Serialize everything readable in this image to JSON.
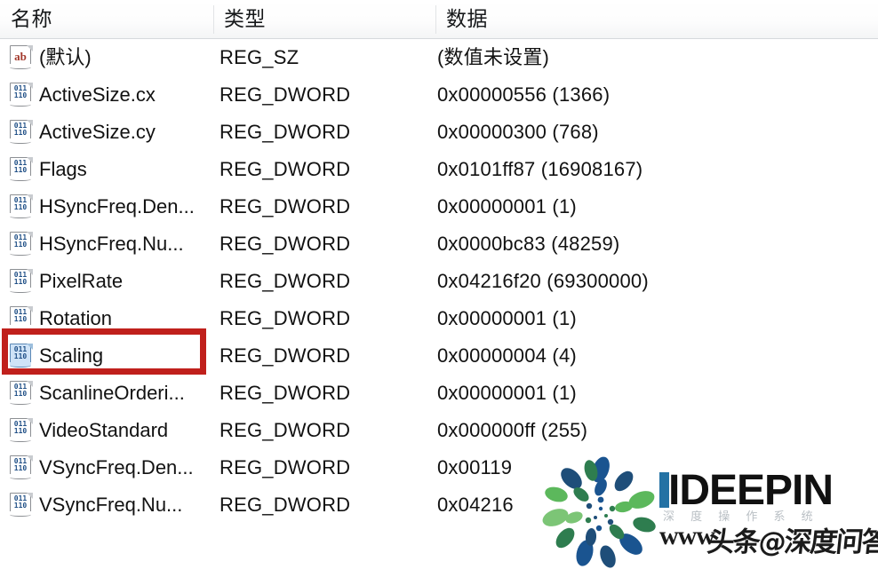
{
  "window": {
    "app": "registry-editor-value-list"
  },
  "columns": {
    "name": "名称",
    "type": "类型",
    "data": "数据"
  },
  "rows": [
    {
      "icon": "string-value-icon",
      "name": "(默认)",
      "type": "REG_SZ",
      "data": "(数值未设置)",
      "selected": false
    },
    {
      "icon": "dword-value-icon",
      "name": "ActiveSize.cx",
      "type": "REG_DWORD",
      "data": "0x00000556 (1366)",
      "selected": false
    },
    {
      "icon": "dword-value-icon",
      "name": "ActiveSize.cy",
      "type": "REG_DWORD",
      "data": "0x00000300 (768)",
      "selected": false
    },
    {
      "icon": "dword-value-icon",
      "name": "Flags",
      "type": "REG_DWORD",
      "data": "0x0101ff87 (16908167)",
      "selected": false
    },
    {
      "icon": "dword-value-icon",
      "name": "HSyncFreq.Den...",
      "type": "REG_DWORD",
      "data": "0x00000001 (1)",
      "selected": false
    },
    {
      "icon": "dword-value-icon",
      "name": "HSyncFreq.Nu...",
      "type": "REG_DWORD",
      "data": "0x0000bc83 (48259)",
      "selected": false
    },
    {
      "icon": "dword-value-icon",
      "name": "PixelRate",
      "type": "REG_DWORD",
      "data": "0x04216f20 (69300000)",
      "selected": false
    },
    {
      "icon": "dword-value-icon",
      "name": "Rotation",
      "type": "REG_DWORD",
      "data": "0x00000001 (1)",
      "selected": false
    },
    {
      "icon": "dword-value-icon",
      "name": "Scaling",
      "type": "REG_DWORD",
      "data": "0x00000004 (4)",
      "selected": true
    },
    {
      "icon": "dword-value-icon",
      "name": "ScanlineOrderi...",
      "type": "REG_DWORD",
      "data": "0x00000001 (1)",
      "selected": false
    },
    {
      "icon": "dword-value-icon",
      "name": "VideoStandard",
      "type": "REG_DWORD",
      "data": "0x000000ff (255)",
      "selected": false
    },
    {
      "icon": "dword-value-icon",
      "name": "VSyncFreq.Den...",
      "type": "REG_DWORD",
      "data": "0x00119",
      "selected": false
    },
    {
      "icon": "dword-value-icon",
      "name": "VSyncFreq.Nu...",
      "type": "REG_DWORD",
      "data": "0x04216",
      "selected": false
    }
  ],
  "annotation": {
    "shape": "rectangle",
    "target": "Scaling",
    "color": "#c0201c"
  },
  "watermark": {
    "brand": "IDEEPIN",
    "subtitle": "深 度 操 作 系 统",
    "url": "www",
    "cn_text": "头条@深度问答",
    "logo_colors": [
      "#1f4e79",
      "#1a5490",
      "#2e7d4f",
      "#4caf50",
      "#7cc576"
    ]
  },
  "icon_glyphs": {
    "string": "ab",
    "dword_top": "011",
    "dword_bottom": "110"
  }
}
